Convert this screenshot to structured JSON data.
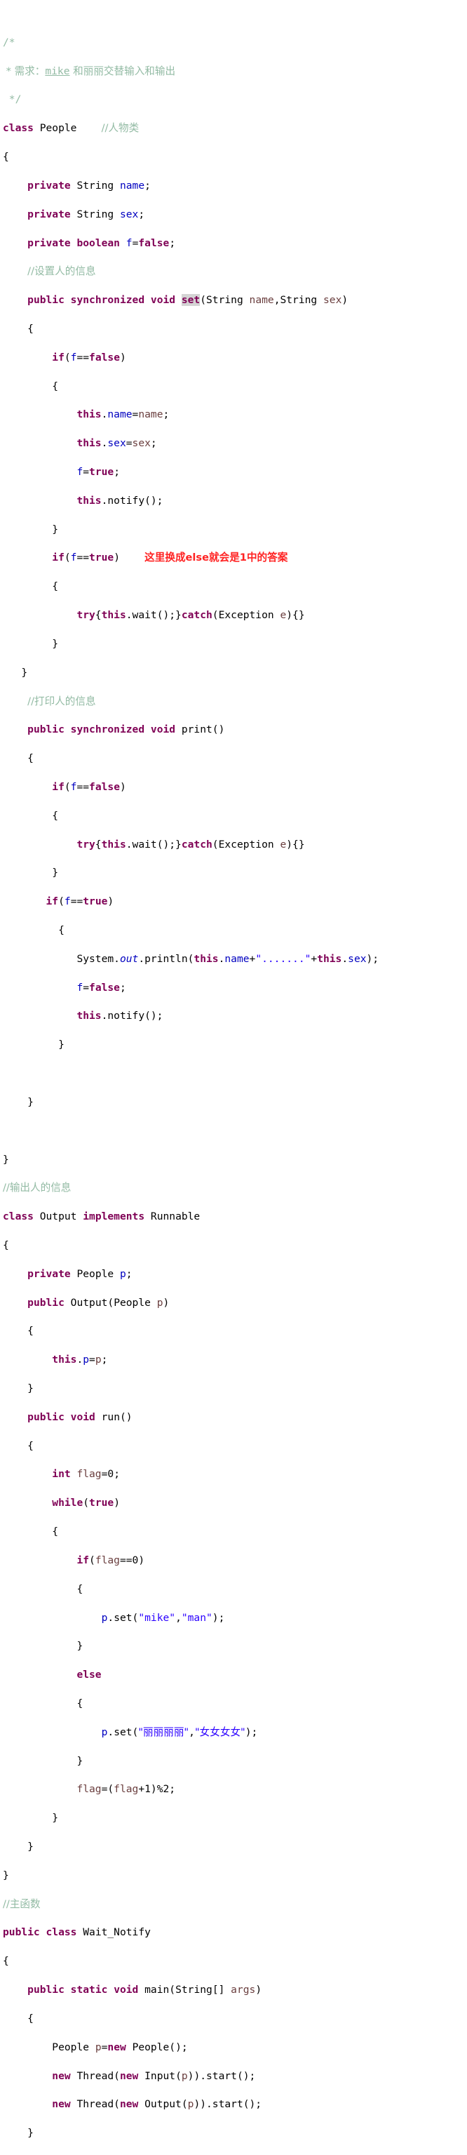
{
  "document": {
    "kind": "java-source-code",
    "language": "Java",
    "class_name": "Wait_Notify",
    "background_color": "#ffffff",
    "colors": {
      "keyword": "#7f0055",
      "comment": "#93bba4",
      "string": "#2a00ff",
      "field": "#0000c0",
      "static_field": "#0000c0",
      "parameter": "#6a3e3e",
      "annotation_red": "#ff2222",
      "occurrence_highlight": "#d4d4d4",
      "plain_text": "#000000"
    }
  },
  "annotations": {
    "red_note": "这里换成else就会是1中的答案",
    "highlighted_token": "set",
    "underlined_token": "mike"
  },
  "code": {
    "header_comment": {
      "open": "/*",
      "body_prefix": " * 需求：",
      "body_link": "mike",
      "body_suffix": " 和丽丽交替输入和输出",
      "close": " */"
    },
    "comments": {
      "people_class": "//人物类",
      "set_info": "//设置人的信息",
      "print_info": "//打印人的信息",
      "output_info": "//输出人的信息",
      "main_func": "//主函数"
    },
    "identifiers": {
      "class_people": "People",
      "class_output": "Output",
      "class_wait_notify": "Wait_Notify",
      "interface_runnable": "Runnable",
      "type_string": "String",
      "type_boolean": "boolean",
      "type_int": "int",
      "type_void": "void",
      "field_name": "name",
      "field_sex": "sex",
      "field_f": "f",
      "field_p": "p",
      "local_flag": "flag",
      "method_set": "set",
      "method_print": "print",
      "method_run": "run",
      "method_main": "main",
      "method_wait": "wait",
      "method_notify": "notify",
      "method_start": "start",
      "class_system": "System",
      "static_out": "out",
      "method_println": "println",
      "class_exception": "Exception",
      "var_e": "e",
      "class_thread": "Thread",
      "class_input": "Input",
      "args": "args"
    },
    "literals": {
      "false": "false",
      "true": "true",
      "zero": "0",
      "one": "1",
      "two": "2",
      "str_mike": "\"mike\"",
      "str_man": "\"man\"",
      "str_lili": "\"丽丽丽丽\"",
      "str_nv": "\"女女女女\"",
      "str_dots": "\".......\""
    },
    "keywords": {
      "class": "class",
      "private": "private",
      "public": "public",
      "static": "static",
      "synchronized": "synchronized",
      "implements": "implements",
      "if": "if",
      "else": "else",
      "while": "while",
      "try": "try",
      "catch": "catch",
      "this": "this",
      "new": "new",
      "void": "void",
      "int": "int",
      "boolean": "boolean",
      "true": "true",
      "false": "false"
    },
    "lines": [
      "/*",
      " * 需求：mike 和丽丽交替输入和输出",
      " */",
      "class People    //人物类",
      "{",
      "    private String name;",
      "    private String sex;",
      "    private boolean f=false;",
      "    //设置人的信息",
      "    public synchronized void set(String name,String sex)",
      "    {",
      "        if(f==false)",
      "        {",
      "            this.name=name;",
      "            this.sex=sex;",
      "            f=true;",
      "            this.notify();",
      "        }",
      "        if(f==true)    这里换成else就会是1中的答案",
      "        {",
      "            try{this.wait();}catch(Exception e){}",
      "        }",
      "    }",
      "    //打印人的信息",
      "    public synchronized void print()",
      "    {",
      "        if(f==false)",
      "        {",
      "            try{this.wait();}catch(Exception e){}",
      "        }",
      "        if(f==true)",
      "        {",
      "            System.out.println(this.name+\".......\"+this.sex);",
      "            f=false;",
      "            this.notify();",
      "        }",
      "",
      "    }",
      "",
      "}",
      "//输出人的信息",
      "class Output implements Runnable",
      "{",
      "    private People p;",
      "    public Output(People p)",
      "    {",
      "        this.p=p;",
      "    }",
      "    public void run()",
      "    {",
      "        int flag=0;",
      "        while(true)",
      "        {",
      "            if(flag==0)",
      "            {",
      "                p.set(\"mike\",\"man\");",
      "            }",
      "            else",
      "            {",
      "                p.set(\"丽丽丽丽\",\"女女女女\");",
      "            }",
      "            flag=(flag+1)%2;",
      "        }",
      "    }",
      "}",
      "//主函数",
      "public class Wait_Notify",
      "{",
      "    public static void main(String[] args)",
      "    {",
      "        People p=new People();",
      "        new Thread(new Input(p)).start();",
      "        new Thread(new Output(p)).start();",
      "    }"
    ]
  }
}
